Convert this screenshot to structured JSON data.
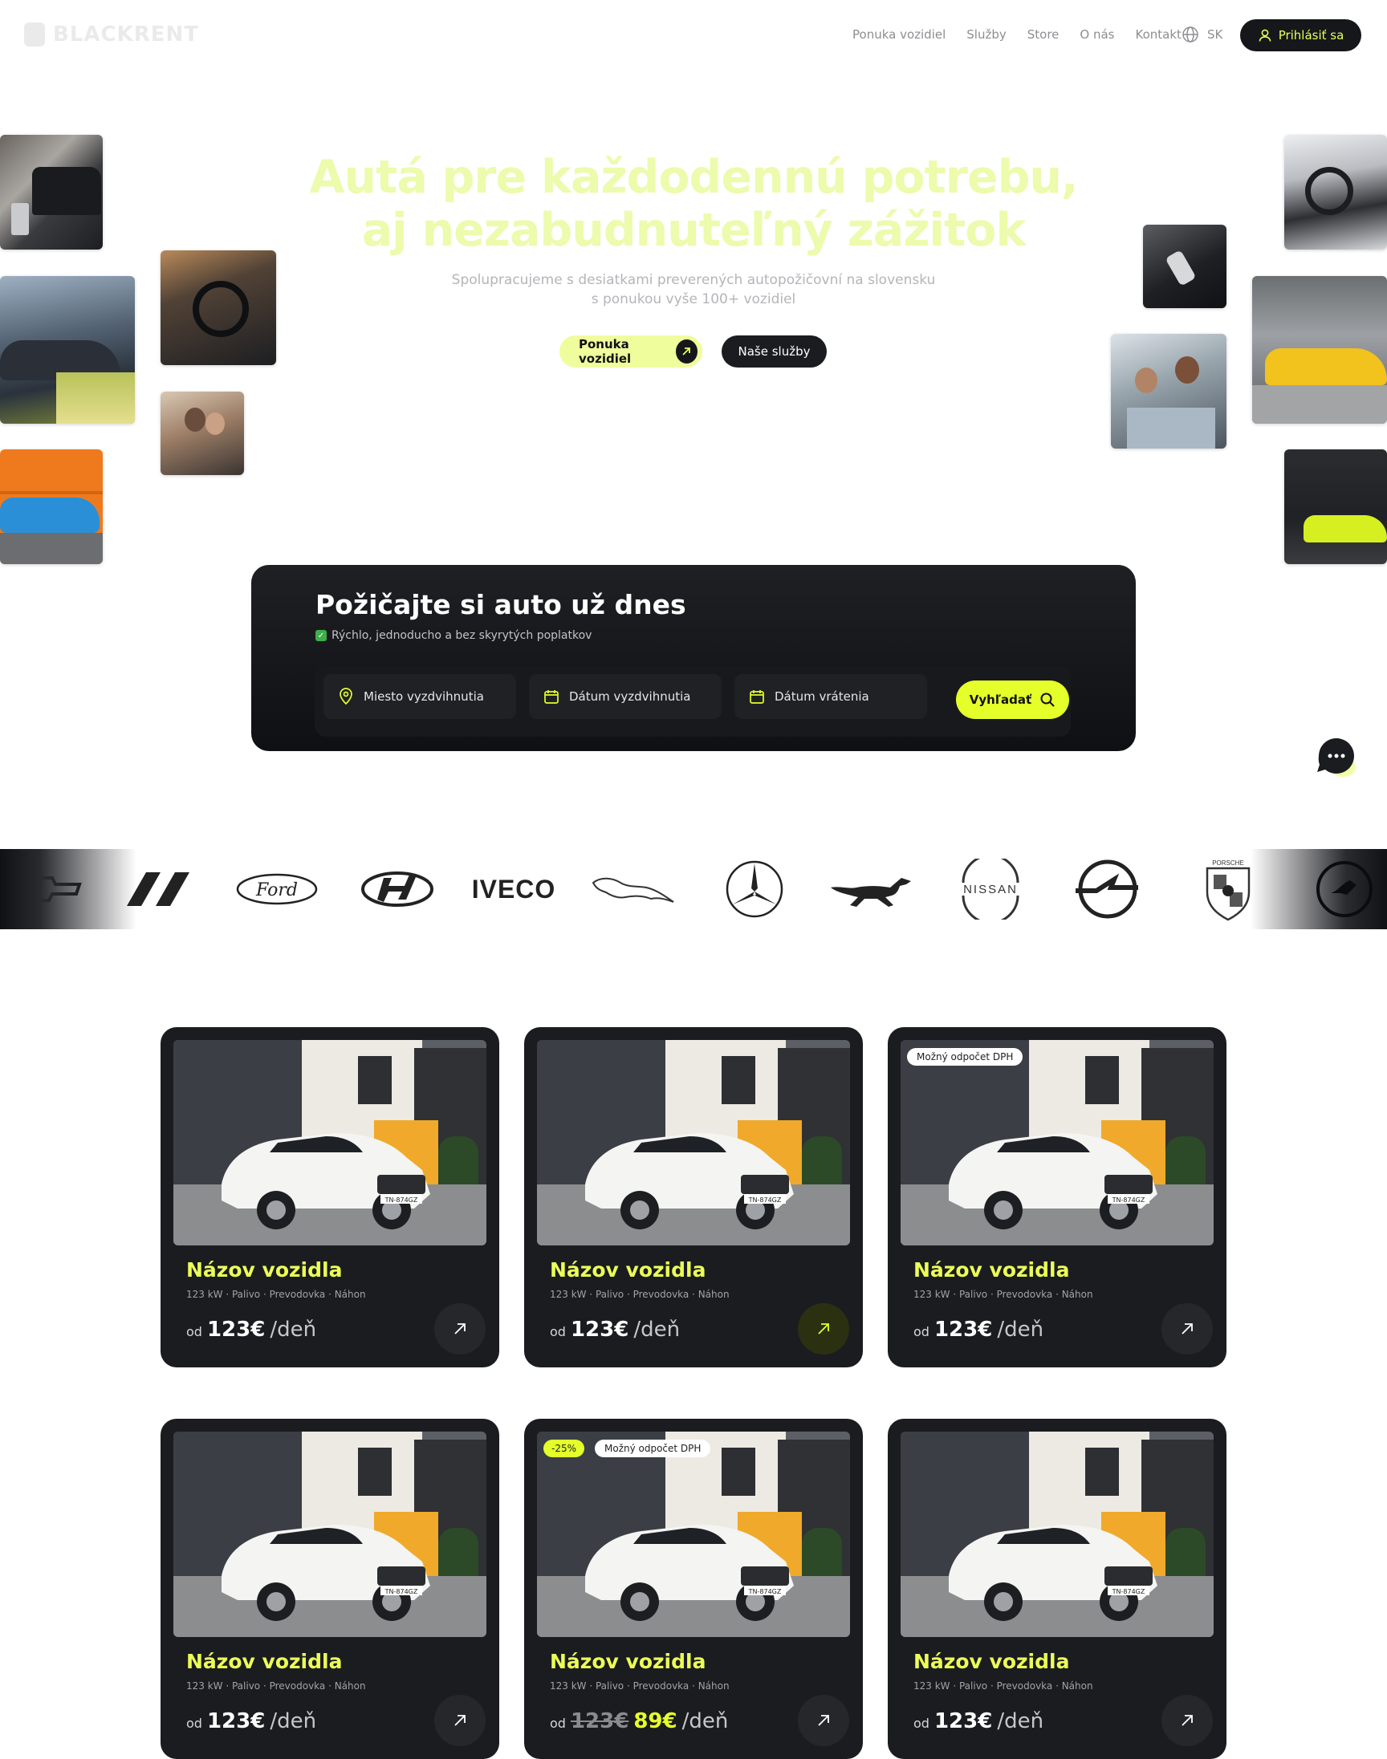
{
  "header": {
    "logo_text": "BLACKRENT",
    "nav": [
      "Ponuka vozidiel",
      "Služby",
      "Store",
      "O nás",
      "Kontakt"
    ],
    "language": "SK",
    "login_label": "Prihlásiť sa",
    "globe_icon": "globe-icon",
    "user_icon": "user-icon"
  },
  "hero": {
    "title_line1": "Autá pre každodennú potrebu,",
    "title_line2": "aj nezabudnuteľný zážitok",
    "subtitle_line1": "Spolupracujeme s desiatkami preverených autopožičovní na slovensku",
    "subtitle_line2": "s ponukou vyše 100+ vozidiel",
    "primary_button": "Ponuka vozidiel",
    "secondary_button": "Naše služby"
  },
  "search": {
    "title": "Požičajte si auto už dnes",
    "subtitle": "Rýchlo, jednoducho a bez skyrytých poplatkov",
    "pickup_place": "Miesto vyzdvihnutia",
    "pickup_date": "Dátum vyzdvihnutia",
    "return_date": "Dátum vrátenia",
    "search_button": "Vyhľadať"
  },
  "brands": [
    "Chevrolet",
    "Dodge",
    "Ford",
    "Hyundai",
    "IVECO",
    "Jaguar",
    "Mercedes-Benz",
    "Mustang",
    "NISSAN",
    "Opel",
    "Porsche",
    "Škoda"
  ],
  "brand_texts": {
    "ford": "Ford",
    "iveco": "IVECO",
    "nissan": "NISSAN",
    "porsche": "PORSCHE"
  },
  "cars": [
    {
      "name": "Názov vozidla",
      "spec": "123 kW · Palivo · Prevodovka · Náhon",
      "od": "od",
      "price": "123€",
      "unit": "/deň",
      "badges": []
    },
    {
      "name": "Názov vozidla",
      "spec": "123 kW · Palivo · Prevodovka · Náhon",
      "od": "od",
      "price": "123€",
      "unit": "/deň",
      "badges": []
    },
    {
      "name": "Názov vozidla",
      "spec": "123 kW · Palivo · Prevodovka · Náhon",
      "od": "od",
      "price": "123€",
      "unit": "/deň",
      "badges": [
        "Možný odpočet DPH"
      ]
    },
    {
      "name": "Názov vozidla",
      "spec": "123 kW · Palivo · Prevodovka · Náhon",
      "od": "od",
      "price": "123€",
      "unit": "/deň",
      "badges": []
    },
    {
      "name": "Názov vozidla",
      "spec": "123 kW · Palivo · Prevodovka · Náhon",
      "od": "od",
      "old_price": "123€",
      "price": "89€",
      "unit": "/deň",
      "discount": "-25%",
      "badges": [
        "Možný odpočet DPH"
      ]
    },
    {
      "name": "Názov vozidla",
      "spec": "123 kW · Palivo · Prevodovka · Náhon",
      "od": "od",
      "price": "123€",
      "unit": "/deň",
      "badges": []
    }
  ],
  "plate_text": "TN-874GZ",
  "colors": {
    "accent": "#e4ff2a",
    "dark": "#1b1c20",
    "hero_title": "#ecfbac"
  }
}
